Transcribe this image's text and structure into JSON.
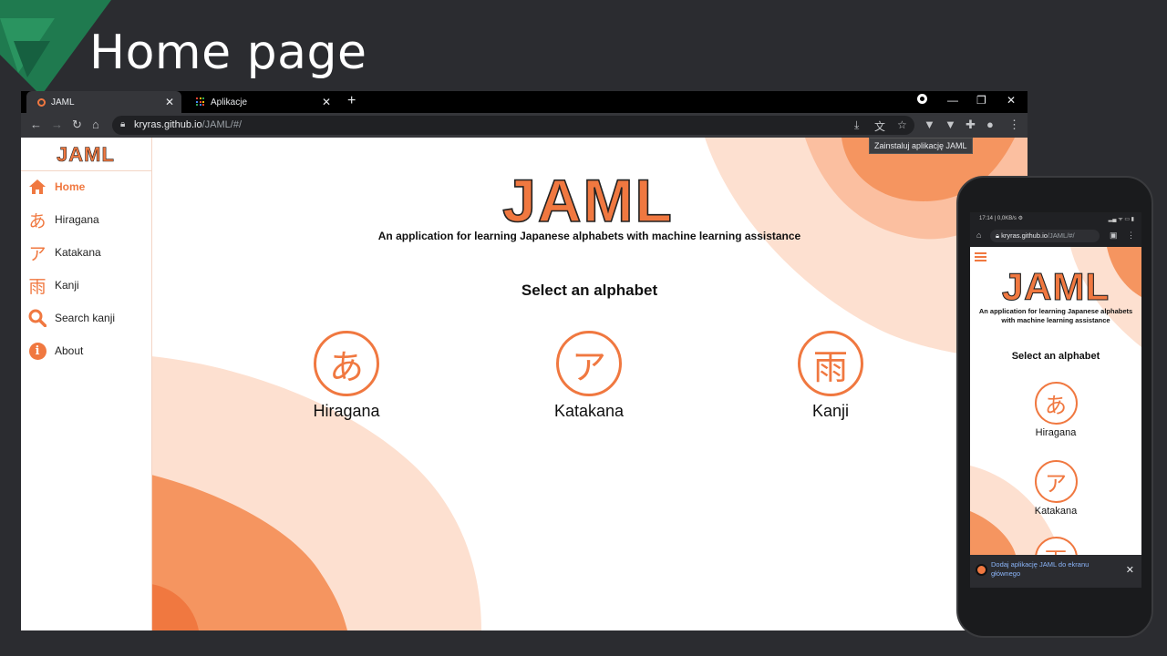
{
  "slide": {
    "title": "Home page"
  },
  "browser": {
    "tabs": [
      {
        "label": "JAML",
        "active": true
      },
      {
        "label": "Aplikacje",
        "active": false
      }
    ],
    "new_tab": "+",
    "window_controls": {
      "minimize": "—",
      "maximize": "❐",
      "close": "✕"
    },
    "url_host": "kryras.github.io",
    "url_path": "/JAML/#/",
    "install_tooltip": "Zainstaluj aplikację JAML"
  },
  "app": {
    "logo": "JAML",
    "nav": [
      {
        "label": "Home",
        "icon": "home-icon",
        "active": true
      },
      {
        "label": "Hiragana",
        "icon": "hiragana-a-icon",
        "glyph": "あ"
      },
      {
        "label": "Katakana",
        "icon": "katakana-a-icon",
        "glyph": "ア"
      },
      {
        "label": "Kanji",
        "icon": "kanji-rain-icon",
        "glyph": "雨"
      },
      {
        "label": "Search kanji",
        "icon": "search-icon"
      },
      {
        "label": "About",
        "icon": "info-icon",
        "glyph": "i"
      }
    ],
    "tagline": "An application for learning Japanese alphabets with machine learning assistance",
    "select_title": "Select an alphabet",
    "alphabets": [
      {
        "label": "Hiragana",
        "glyph": "あ"
      },
      {
        "label": "Katakana",
        "glyph": "ア"
      },
      {
        "label": "Kanji",
        "glyph": "雨"
      }
    ]
  },
  "phone": {
    "status_left": "17:14 | 0,0KB/s ⚙",
    "status_right": "▂▄ ᯤ ▭ ▮",
    "url_host": "kryras.github.io",
    "url_path": "/JAML/#/",
    "tagline": "An application for learning Japanese alphabets with machine learning assistance",
    "select_title": "Select an alphabet",
    "alphabets": [
      {
        "label": "Hiragana",
        "glyph": "あ"
      },
      {
        "label": "Katakana",
        "glyph": "ア"
      },
      {
        "label": "",
        "glyph": "雨"
      }
    ],
    "banner_text": "Dodaj aplikację JAML do ekranu głównego",
    "banner_close": "✕"
  },
  "colors": {
    "accent": "#f07840",
    "blob_light": "#fde0d0",
    "blob_mid": "#fbbfa0",
    "blob_dark": "#f59560",
    "slide_bg": "#2b2c30",
    "brand_green": "#1f7a4f"
  }
}
